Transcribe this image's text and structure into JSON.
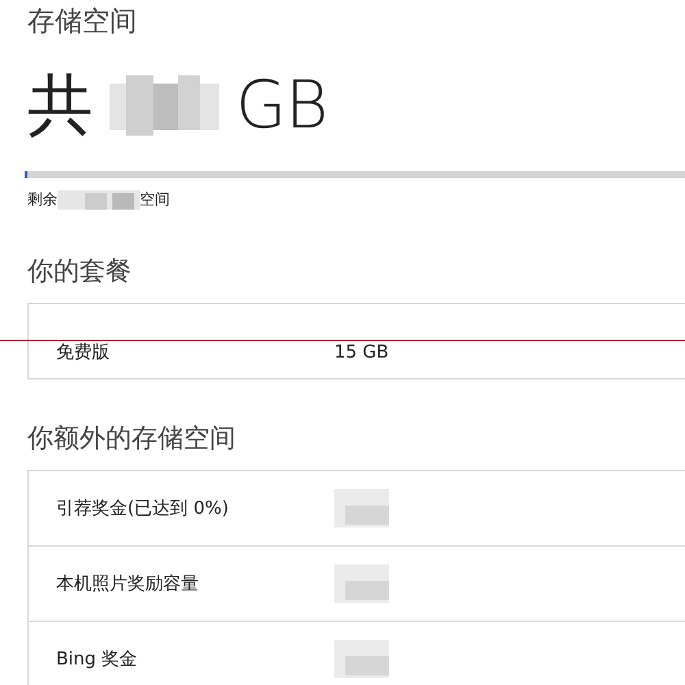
{
  "header": {
    "title": "存储空间",
    "total_prefix": "共",
    "total_unit": "GB"
  },
  "usage": {
    "level": 0.005,
    "remaining_prefix": "剩余",
    "remaining_suffix": "空间"
  },
  "plan": {
    "title": "你的套餐",
    "rows": [
      {
        "label": "免费版",
        "value": "15 GB"
      }
    ]
  },
  "extra": {
    "title": "你额外的存储空间",
    "rows": [
      {
        "label": "引荐奖金(已达到 0%)",
        "value_redacted": true
      },
      {
        "label": "本机照片奖励容量",
        "value_redacted": true
      },
      {
        "label": "Bing 奖金",
        "value_redacted": true
      }
    ]
  }
}
